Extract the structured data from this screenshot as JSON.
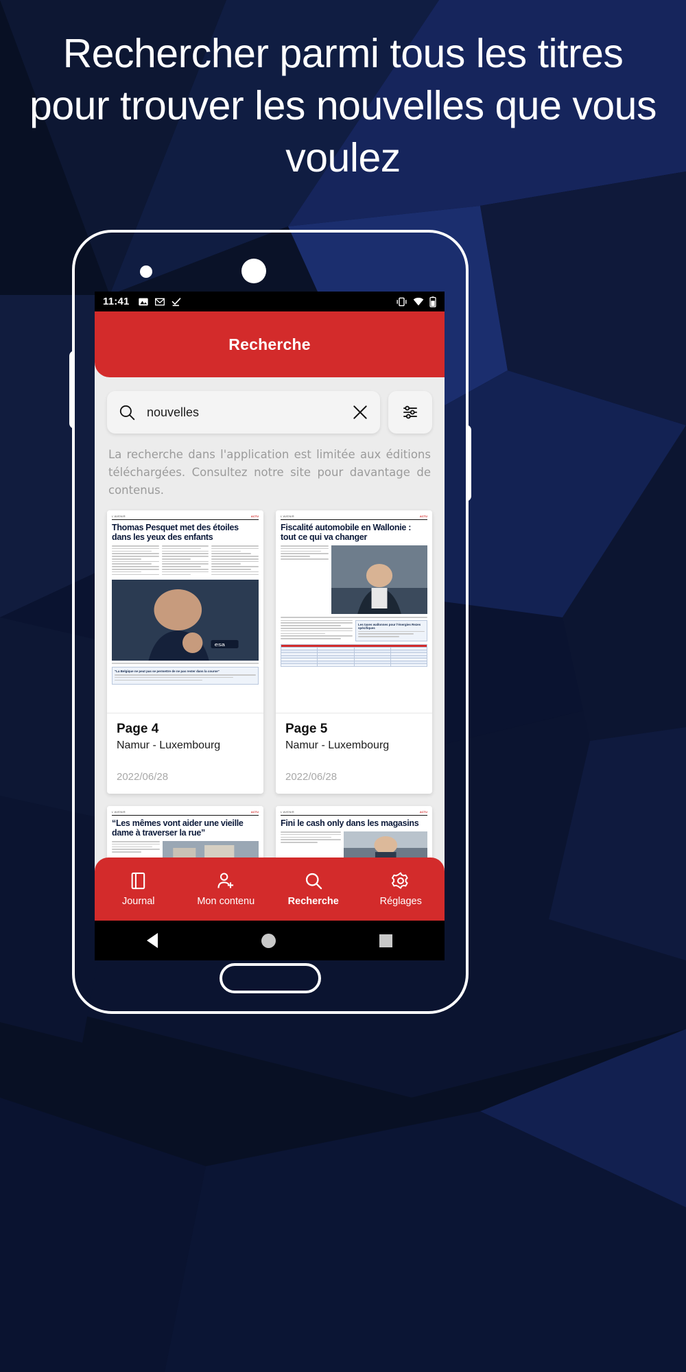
{
  "headline": "Rechercher parmi tous les titres pour trouver les nouvelles que vous voulez",
  "colors": {
    "brand_red": "#d32b2b",
    "background_navy": "#0a1228",
    "screen_grey": "#ececec",
    "muted_text": "#9b9b9b"
  },
  "phone": {
    "status_bar": {
      "time": "11:41",
      "left_icons": [
        "photos-icon",
        "gmail-icon",
        "checkmark-icon"
      ],
      "right_icons": [
        "vibrate-icon",
        "wifi-icon",
        "battery-icon"
      ]
    },
    "app_bar": {
      "title": "Recherche"
    },
    "search": {
      "icon": "search-icon",
      "value": "nouvelles",
      "placeholder": "Recherche",
      "clear_icon": "close-icon",
      "filter_icon": "filter-sliders-icon"
    },
    "info_text": "La recherche dans l'application est limitée aux éditions téléchargées. Consultez notre site pour davantage de contenus.",
    "results": [
      {
        "headline": "Thomas Pesquet met des étoiles dans les yeux des enfants",
        "page": "Page 4",
        "edition": "Namur - Luxembourg",
        "date": "2022/06/28"
      },
      {
        "headline": "Fiscalité automobile en Wallonie : tout ce qui va changer",
        "page": "Page 5",
        "edition": "Namur - Luxembourg",
        "date": "2022/06/28"
      },
      {
        "headline": "“Les mêmes vont aider une vieille dame à traverser la rue”",
        "page": "",
        "edition": "",
        "date": ""
      },
      {
        "headline": "Fini le cash only dans les magasins",
        "page": "",
        "edition": "",
        "date": ""
      }
    ],
    "bottom_nav": [
      {
        "label": "Journal",
        "icon": "book-icon",
        "active": false
      },
      {
        "label": "Mon contenu",
        "icon": "person-add-icon",
        "active": false
      },
      {
        "label": "Recherche",
        "icon": "search-icon",
        "active": true
      },
      {
        "label": "Réglages",
        "icon": "gear-icon",
        "active": false
      }
    ],
    "android_nav": [
      "back-icon",
      "home-icon",
      "recents-icon"
    ]
  }
}
